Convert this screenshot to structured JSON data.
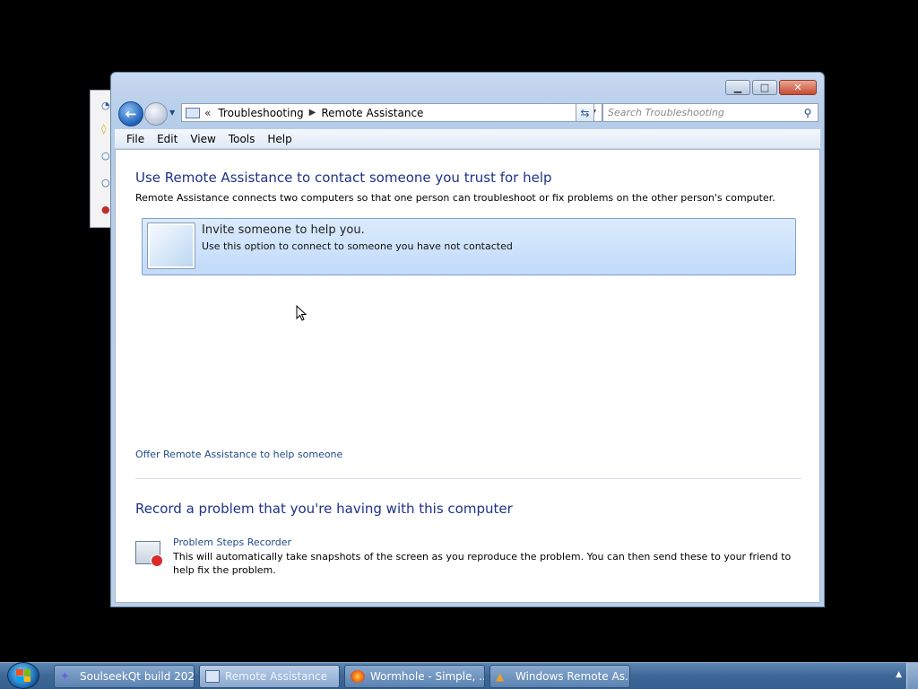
{
  "window": {
    "title": "Remote Assistance"
  },
  "navigation": {
    "breadcrumb_overflow": "«",
    "breadcrumbs": [
      "Troubleshooting",
      "Remote Assistance"
    ],
    "search_placeholder": "Search Troubleshooting"
  },
  "menu": [
    "File",
    "Edit",
    "View",
    "Tools",
    "Help"
  ],
  "content": {
    "heading": "Use Remote Assistance to contact someone you trust for help",
    "description": "Remote Assistance connects two computers so that one person can troubleshoot or fix problems on the other person's computer.",
    "invite_option": {
      "title": "Invite someone to help you.",
      "description": "Use this option to connect to someone you have not contacted"
    },
    "offer_link": "Offer Remote Assistance to help someone",
    "record_heading": "Record a problem that you're having with this computer",
    "psr": {
      "link": "Problem Steps Recorder",
      "description": "This will automatically take snapshots of the screen as you reproduce the problem. You can then send these to your friend to help fix the problem."
    }
  },
  "taskbar": {
    "tasks": [
      {
        "label": "SoulseekQt build 202..."
      },
      {
        "label": "Remote Assistance"
      },
      {
        "label": "Wormhole - Simple, ..."
      },
      {
        "label": "Windows Remote As..."
      }
    ]
  },
  "colors": {
    "heading": "#1e3287",
    "link": "#1f4b8a",
    "selection": "#c1dbfa",
    "taskbar": "#3e6796"
  }
}
